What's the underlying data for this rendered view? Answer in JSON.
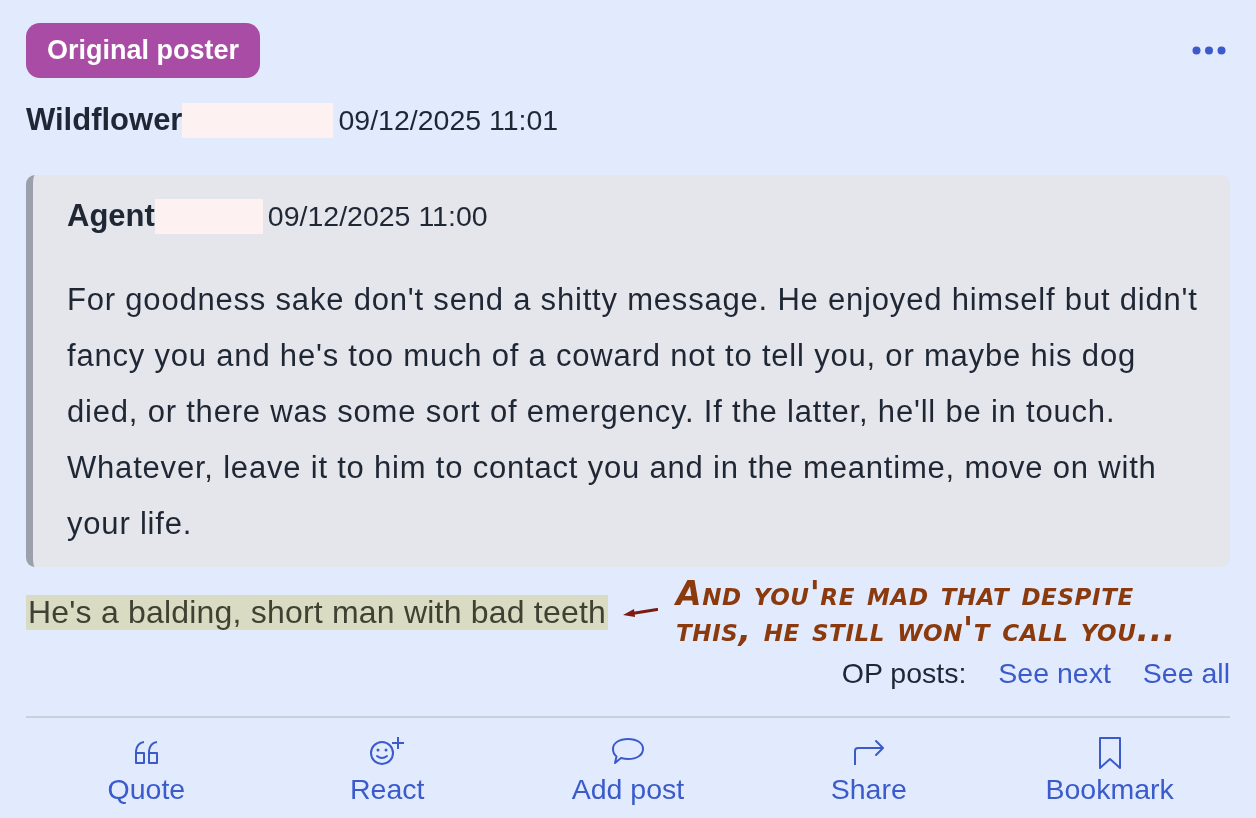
{
  "post": {
    "badge": "Original poster",
    "author": "Wildflower",
    "author_redacted": true,
    "timestamp": "09/12/2025 11:01",
    "quote": {
      "author": "Agent",
      "author_redacted": true,
      "timestamp": "09/12/2025 11:00",
      "text": "For goodness sake don't send a shitty message. He enjoyed himself but didn't fancy you and he's too much of a coward not to tell you, or maybe his dog died, or there was some sort of emergency. If the latter, he'll be in touch. Whatever, leave it to him to contact you and in the meantime, move on with your life."
    },
    "body": {
      "text": "He's a balding, short man with bad teeth",
      "highlighted": true
    },
    "op_posts": {
      "label": "OP posts:",
      "links": [
        "See next",
        "See all"
      ]
    },
    "actions": [
      "Quote",
      "React",
      "Add post",
      "Share",
      "Bookmark"
    ]
  },
  "annotation": {
    "text": "And you're mad that despite this, he still won't call you..."
  }
}
